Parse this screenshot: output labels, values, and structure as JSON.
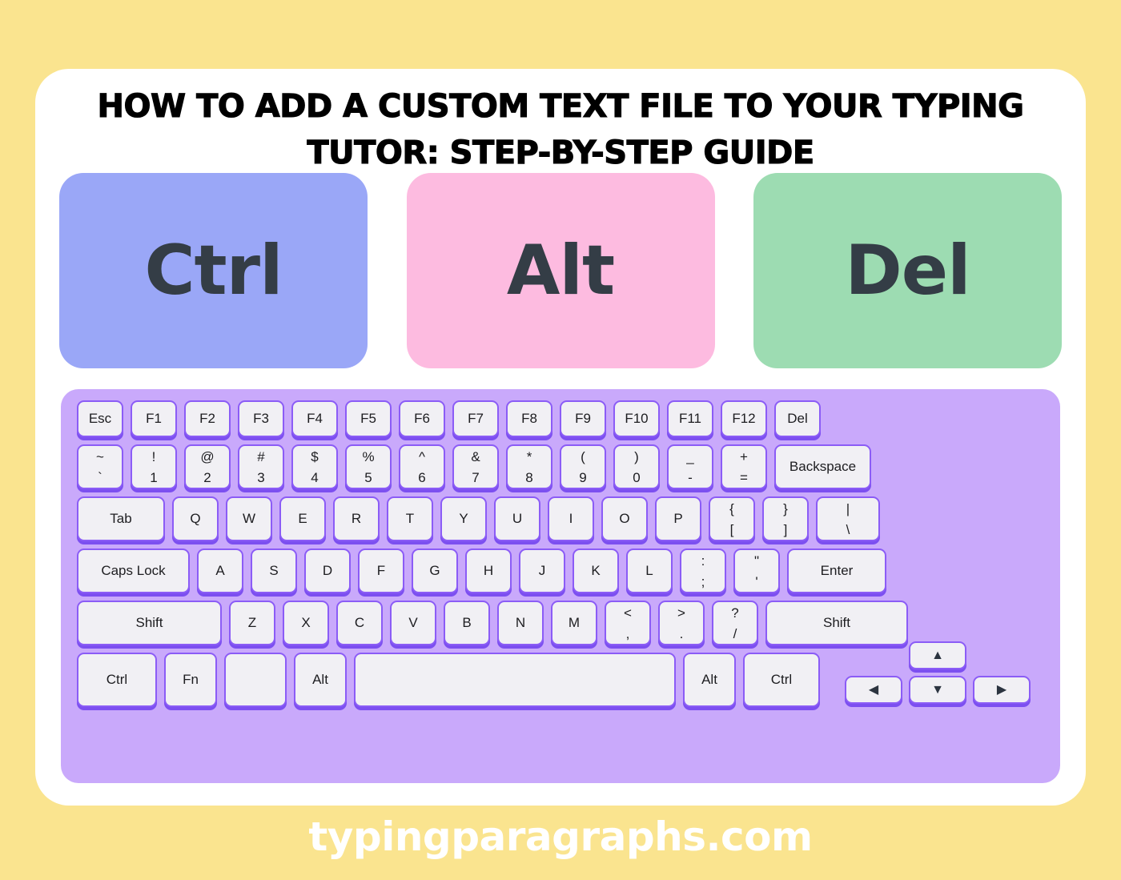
{
  "colors": {
    "background": "#fae48f",
    "card": "#ffffff",
    "keyboard_panel": "#c9a9fb",
    "key_face": "#f1f0f4",
    "key_border": "#8b5cf6",
    "key_text": "#1d1d20",
    "ctrl_card": "#9aa7f7",
    "alt_card": "#fdbbe0",
    "del_card": "#9ddcb2",
    "big_key_text": "#343d46",
    "footer_text": "#ffffff"
  },
  "header": {
    "title": "HOW TO ADD A CUSTOM TEXT FILE TO YOUR TYPING TUTOR: STEP-BY-STEP GUIDE"
  },
  "big_keys": [
    {
      "label": "Ctrl",
      "color": "#9aa7f7"
    },
    {
      "label": "Alt",
      "color": "#fdbbe0"
    },
    {
      "label": "Del",
      "color": "#9ddcb2"
    }
  ],
  "keyboard": {
    "function_row": [
      {
        "label": "Esc"
      },
      {
        "label": "F1"
      },
      {
        "label": "F2"
      },
      {
        "label": "F3"
      },
      {
        "label": "F4"
      },
      {
        "label": "F5"
      },
      {
        "label": "F6"
      },
      {
        "label": "F7"
      },
      {
        "label": "F8"
      },
      {
        "label": "F9"
      },
      {
        "label": "F10"
      },
      {
        "label": "F11"
      },
      {
        "label": "F12"
      },
      {
        "label": "Del"
      }
    ],
    "number_row": [
      {
        "top": "~",
        "bottom": "`"
      },
      {
        "top": "!",
        "bottom": "1"
      },
      {
        "top": "@",
        "bottom": "2"
      },
      {
        "top": "#",
        "bottom": "3"
      },
      {
        "top": "$",
        "bottom": "4"
      },
      {
        "top": "%",
        "bottom": "5"
      },
      {
        "top": "^",
        "bottom": "6"
      },
      {
        "top": "&",
        "bottom": "7"
      },
      {
        "top": "*",
        "bottom": "8"
      },
      {
        "top": "(",
        "bottom": "9"
      },
      {
        "top": ")",
        "bottom": "0"
      },
      {
        "top": "_",
        "bottom": "-"
      },
      {
        "top": "+",
        "bottom": "="
      },
      {
        "label": "Backspace"
      }
    ],
    "top_row": [
      {
        "label": "Tab"
      },
      {
        "label": "Q"
      },
      {
        "label": "W"
      },
      {
        "label": "E"
      },
      {
        "label": "R"
      },
      {
        "label": "T"
      },
      {
        "label": "Y"
      },
      {
        "label": "U"
      },
      {
        "label": "I"
      },
      {
        "label": "O"
      },
      {
        "label": "P"
      },
      {
        "top": "{",
        "bottom": "["
      },
      {
        "top": "}",
        "bottom": "]"
      },
      {
        "top": "|",
        "bottom": "\\"
      }
    ],
    "home_row": [
      {
        "label": "Caps Lock"
      },
      {
        "label": "A"
      },
      {
        "label": "S"
      },
      {
        "label": "D"
      },
      {
        "label": "F"
      },
      {
        "label": "G"
      },
      {
        "label": "H"
      },
      {
        "label": "J"
      },
      {
        "label": "K"
      },
      {
        "label": "L"
      },
      {
        "top": ":",
        "bottom": ";"
      },
      {
        "top": "\"",
        "bottom": "'"
      },
      {
        "label": "Enter"
      }
    ],
    "shift_row": [
      {
        "label": "Shift"
      },
      {
        "label": "Z"
      },
      {
        "label": "X"
      },
      {
        "label": "C"
      },
      {
        "label": "V"
      },
      {
        "label": "B"
      },
      {
        "label": "N"
      },
      {
        "label": "M"
      },
      {
        "top": "<",
        "bottom": ","
      },
      {
        "top": ">",
        "bottom": "."
      },
      {
        "top": "?",
        "bottom": "/"
      },
      {
        "label": "Shift"
      }
    ],
    "bottom_row": [
      {
        "label": "Ctrl"
      },
      {
        "label": "Fn"
      },
      {
        "label": ""
      },
      {
        "label": "Alt"
      },
      {
        "label": ""
      },
      {
        "label": "Alt"
      },
      {
        "label": "Ctrl"
      }
    ],
    "arrow_keys": [
      {
        "name": "arrow-up-key",
        "glyph": "▲"
      },
      {
        "name": "arrow-left-key",
        "glyph": "◀"
      },
      {
        "name": "arrow-down-key",
        "glyph": "▼"
      },
      {
        "name": "arrow-right-key",
        "glyph": "▶"
      }
    ]
  },
  "footer": {
    "site": "typingparagraphs.com"
  }
}
